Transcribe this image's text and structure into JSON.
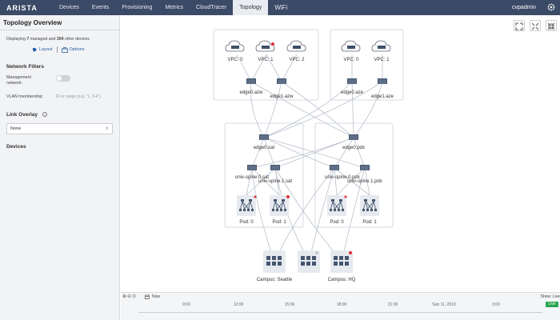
{
  "header": {
    "logo": "ARISTA",
    "nav": [
      "Devices",
      "Events",
      "Provisioning",
      "Metrics",
      "CloudTracer",
      "Topology",
      "WiFi"
    ],
    "active": "Topology",
    "user": "cvpadmin"
  },
  "sidebar": {
    "title": "Topology Overview",
    "display_prefix": "Displaying ",
    "managed_count": "7",
    "display_mid": " managed and ",
    "other_count": "304",
    "display_suffix": " other devices",
    "layout_label": "Layout",
    "options_label": "Options",
    "network_filters_heading": "Network Filters",
    "management_label_1": "Management",
    "management_label_2": "network:",
    "vlan_label": "VLAN membership:",
    "vlan_placeholder": "ID or range (e.g. \"1, 3-4\")",
    "link_overlay_heading": "Link Overlay",
    "link_overlay_value": "None",
    "devices_heading": "Devices"
  },
  "topology": {
    "vpcs_left": [
      "VPC: 0",
      "VPC: 1",
      "VPC: 2"
    ],
    "vpcs_right": [
      "VPC: 0",
      "VPC: 1"
    ],
    "edges_top": [
      "edge0.azw",
      "edge1.azw",
      "edge0.aze",
      "edge1.aze"
    ],
    "edge_sat": "edge0.sat",
    "edge_pdx": "edge0.pdx",
    "spines_sat": [
      "univ-spine.0.sat",
      "univ-spine.1.sat"
    ],
    "spines_pdx": [
      "univ-spine.0.pdx",
      "univ-spine.1.pdx"
    ],
    "pods_sat": [
      "Pod: 0",
      "Pod: 1"
    ],
    "pods_pdx": [
      "Pod: 0",
      "Pod: 1"
    ],
    "campus": [
      "Campus: Seattle",
      "Campus: HQ"
    ]
  },
  "timeline": {
    "now_label": "Now",
    "ticks": [
      "9:00",
      "12:00",
      "15:00",
      "18:00",
      "21:00",
      "Sep 11, 2019",
      "3:00"
    ],
    "show_label": "Show: Live",
    "live_label": "Live"
  },
  "colors": {
    "topbar": "#3b4a66",
    "alert": "#e0313a",
    "live": "#2aa44f",
    "link": "#b9c1cc"
  }
}
